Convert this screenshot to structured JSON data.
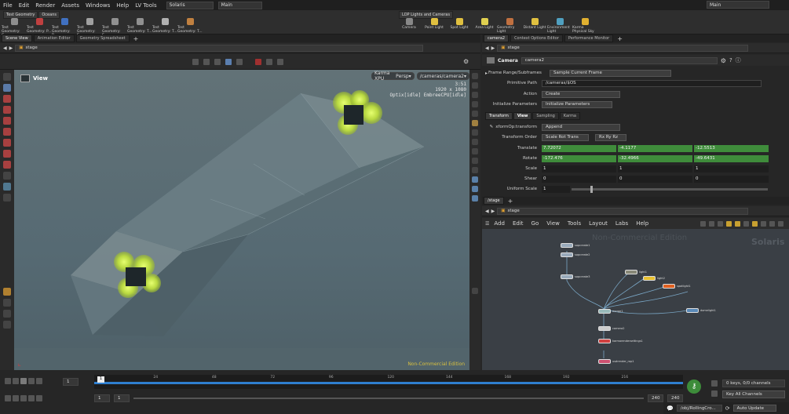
{
  "menubar": {
    "items": [
      "File",
      "Edit",
      "Render",
      "Assets",
      "Windows",
      "Help",
      "LV Tools"
    ],
    "desktop": "Solaris",
    "context": "Main",
    "right_desktop": "Main"
  },
  "shelf": {
    "tabs": [
      "Test Geometry",
      "Oceans"
    ],
    "tools": [
      {
        "label": "Test Geometry: C...",
        "color": "#8e8e8e"
      },
      {
        "label": "Test Geometry: P...",
        "color": "#c04040"
      },
      {
        "label": "Test Geometry: R...",
        "color": "#4070c0"
      },
      {
        "label": "Test Geometry: S...",
        "color": "#a0a0a0"
      },
      {
        "label": "Test Geometry: S...",
        "color": "#909090"
      },
      {
        "label": "Test Geometry: T...",
        "color": "#909090"
      },
      {
        "label": "Test Geometry: T...",
        "color": "#b0b0b0"
      },
      {
        "label": "Test Geometry: T...",
        "color": "#c08040"
      }
    ],
    "lop_tab": "LOP Lights and Cameras",
    "lop_tools": [
      {
        "label": "Camera",
        "color": "#888"
      },
      {
        "label": "Point Light",
        "color": "#e0c040"
      },
      {
        "label": "Spot Light",
        "color": "#e0c040"
      },
      {
        "label": "Area Light",
        "color": "#e0d050"
      },
      {
        "label": "Geometry Light",
        "color": "#c07040"
      },
      {
        "label": "Distant Light",
        "color": "#e0c040"
      },
      {
        "label": "Environment Light",
        "color": "#50a0c0"
      },
      {
        "label": "Karma Physical Sky",
        "color": "#e0b030"
      }
    ]
  },
  "left_tabs": [
    "Scene View",
    "Animation Editor",
    "Geometry Spreadsheet"
  ],
  "right_tabs": [
    "camera2",
    "Context Options Editor",
    "Performance Monitor"
  ],
  "path": "stage",
  "viewport": {
    "title": "View",
    "renderer": "Karma XPU",
    "camera_mode": "Persp",
    "camera_path": "/cameras/camera2",
    "time": "3:51",
    "resolution": "1920 x 1080",
    "status": "Optix[idle] EmbreeCPU[idle]",
    "watermark": "Non-Commercial Edition"
  },
  "params": {
    "node_type": "Camera",
    "node_name": "camera2",
    "frame_range_label": "Frame Range/Subframes",
    "frame_range_value": "Sample Current Frame",
    "primitive_path_label": "Primitive Path",
    "primitive_path": "/cameras/$OS",
    "action_label": "Action",
    "action_value": "Create",
    "init_label": "Initialize Parameters",
    "init_value": "Initialize Parameters",
    "tabs": [
      "Transform",
      "View",
      "Sampling",
      "Karma"
    ],
    "xform_label": "xformOp:transform",
    "xform_value": "Append",
    "order_label": "Transform Order",
    "order_value": "Scale Rot Trans",
    "rot_order": "Rx Ry Rz",
    "translate_label": "Translate",
    "translate": [
      "7.72072",
      "-4.1177",
      "-12.5513"
    ],
    "rotate_label": "Rotate",
    "rotate": [
      "-172.476",
      "-32.4966",
      "-49.6431"
    ],
    "scale_label": "Scale",
    "scale": [
      "1",
      "1",
      "1"
    ],
    "shear_label": "Shear",
    "shear": [
      "0",
      "0",
      "0"
    ],
    "uniform_label": "Uniform Scale",
    "uniform": "1"
  },
  "network": {
    "tab": "/stage",
    "path": "stage",
    "menus": [
      "Add",
      "Edit",
      "Go",
      "View",
      "Tools",
      "Layout",
      "Labs",
      "Help"
    ],
    "watermark": "Non-Commercial Edition",
    "brand": "Solaris",
    "nodes": [
      "sopcreate1",
      "sopcreate2",
      "sopcreate3",
      "merge1",
      "camera2",
      "karmarendersettings1",
      "usdrender_rop1",
      "light1",
      "light2",
      "spotlight1",
      "domelight1"
    ]
  },
  "timeline": {
    "frame": "1",
    "ticks": [
      "1",
      "24",
      "48",
      "72",
      "96",
      "120",
      "144",
      "168",
      "192",
      "216"
    ],
    "start": "1",
    "start2": "1",
    "end": "240",
    "end2": "240",
    "keys": "0 keys, 0/0 channels",
    "key_all": "Key All Channels"
  },
  "status": {
    "path": "/obj/RollingCro...",
    "auto_update": "Auto Update"
  }
}
